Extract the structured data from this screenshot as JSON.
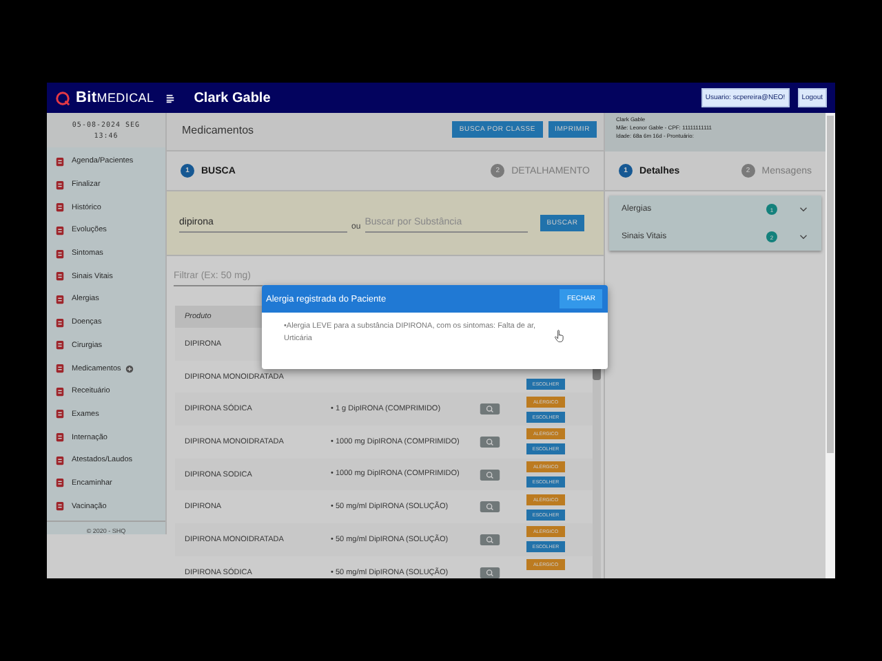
{
  "header": {
    "logo": "**Bit**MEDICAL",
    "patient": "Clark Gable",
    "user": "Usuario: scpereira@NEO!",
    "logout": "Logout"
  },
  "sidebar": {
    "date": "05-08-2024 SEG",
    "time": "13:46",
    "items": [
      {
        "label": "Agenda/Pacientes",
        "badge": false
      },
      {
        "label": "Finalizar",
        "badge": false
      },
      {
        "label": "Histórico",
        "badge": false
      },
      {
        "label": "Evoluções",
        "badge": false
      },
      {
        "label": "Sintomas",
        "badge": false
      },
      {
        "label": "Sinais Vitais",
        "badge": false
      },
      {
        "label": "Alergias",
        "badge": false
      },
      {
        "label": "Doenças",
        "badge": false
      },
      {
        "label": "Cirurgias",
        "badge": false
      },
      {
        "label": "Medicamentos",
        "badge": true
      },
      {
        "label": "Receituário",
        "badge": false
      },
      {
        "label": "Exames",
        "badge": false
      },
      {
        "label": "Internação",
        "badge": false
      },
      {
        "label": "Atestados/Laudos",
        "badge": false
      },
      {
        "label": "Encaminhar",
        "badge": false
      },
      {
        "label": "Vacinação",
        "badge": false
      }
    ],
    "footer": "© 2020 - SHQ"
  },
  "main": {
    "title": "Medicamentos",
    "buttons": [
      "BUSCA POR CLASSE",
      "IMPRIMIR"
    ],
    "steps": [
      {
        "number": "1",
        "label": "BUSCA",
        "selected": true
      },
      {
        "number": "2",
        "label": "DETALHAMENTO",
        "selected": false
      }
    ],
    "search": {
      "value": "dipirona",
      "or": "ou",
      "placeholder": "Buscar por Substância",
      "button": "BUSCAR"
    },
    "filter": {
      "placeholder": "Filtrar (Ex: 50 mg)"
    },
    "table": {
      "columns": [
        "Produto"
      ],
      "rows": [
        {
          "product": "DIPIRONA"
        },
        {
          "product": "DIPIRONA MONOIDRATADA",
          "actions": [
            {
              "label": "ESCOLHER",
              "kind": "primary"
            }
          ]
        },
        {
          "product": "DIPIRONA SÓDICA",
          "presentation": "• 1 g DipIRONA (COMPRIMIDO)",
          "view": true,
          "actions": [
            {
              "label": "ALÉRGICO",
              "kind": "warning"
            },
            {
              "label": "ESCOLHER",
              "kind": "primary"
            }
          ]
        },
        {
          "product": "DIPIRONA MONOIDRATADA",
          "presentation": "• 1000 mg DipIRONA (COMPRIMIDO)",
          "view": true,
          "actions": [
            {
              "label": "ALÉRGICO",
              "kind": "warning"
            },
            {
              "label": "ESCOLHER",
              "kind": "primary"
            }
          ]
        },
        {
          "product": "DIPIRONA SODICA",
          "presentation": "• 1000 mg DipIRONA (COMPRIMIDO)",
          "view": true,
          "actions": [
            {
              "label": "ALÉRGICO",
              "kind": "warning"
            },
            {
              "label": "ESCOLHER",
              "kind": "primary"
            }
          ]
        },
        {
          "product": "DIPIRONA",
          "presentation": "• 50 mg/ml DipIRONA (SOLUÇÃO)",
          "view": true,
          "actions": [
            {
              "label": "ALÉRGICO",
              "kind": "warning"
            },
            {
              "label": "ESCOLHER",
              "kind": "primary"
            }
          ]
        },
        {
          "product": "DIPIRONA MONOIDRATADA",
          "presentation": "• 50 mg/ml DipIRONA (SOLUÇÃO)",
          "view": true,
          "actions": [
            {
              "label": "ALÉRGICO",
              "kind": "warning"
            },
            {
              "label": "ESCOLHER",
              "kind": "primary"
            }
          ]
        },
        {
          "product": "DIPIRONA SÓDICA",
          "presentation": "• 50 mg/ml DipIRONA (SOLUÇÃO)",
          "view": true,
          "actions": [
            {
              "label": "ALÉRGICO",
              "kind": "warning"
            }
          ]
        }
      ]
    }
  },
  "patient_panel": {
    "lines": [
      "Clark Gable",
      "Mãe: Leonor Gable - CPF: 11111111111",
      "Idade: 68a 6m 16d - Prontuário:"
    ],
    "tabs": [
      {
        "number": "1",
        "label": "Detalhes",
        "selected": true
      },
      {
        "number": "2",
        "label": "Mensagens",
        "selected": false
      }
    ],
    "sections": [
      {
        "label": "Alergias",
        "count": "1",
        "expanded": false
      },
      {
        "label": "Sinais Vitais",
        "count": "2",
        "expanded": false
      }
    ]
  },
  "dialog": {
    "title": "Alergia registrada do Paciente",
    "close": "FECHAR",
    "message": "•Alergia LEVE para a substância DIPIRONA, com os sintomas: Falta de ar, Urticária"
  }
}
